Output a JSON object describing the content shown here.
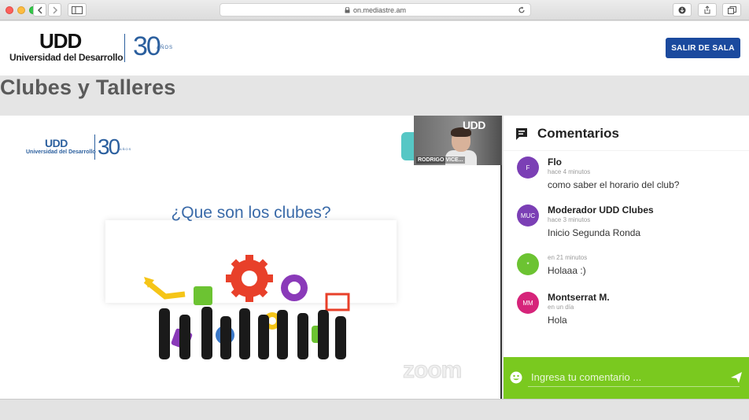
{
  "browser": {
    "url": "on.mediastre.am"
  },
  "header": {
    "logo_mark": "UDD",
    "logo_text": "Universidad del Desarrollo",
    "anniversary_number": "30",
    "anniversary_text": "AÑOS",
    "exit_button_label": "SALIR DE SALA"
  },
  "page": {
    "title": "Clubes y Talleres"
  },
  "presentation": {
    "slide_logo_mark": "UDD",
    "slide_logo_text": "Universidad del Desarrollo",
    "slide_anniversary_number": "30",
    "slide_anniversary_text": "AÑOS",
    "slide_question": "¿Que son los clubes?",
    "watermark": "zoom",
    "video_logo": "UDD",
    "video_participant_name": "RODRIGO VICE..."
  },
  "comments": {
    "title": "Comentarios",
    "items": [
      {
        "initials": "F",
        "author": "Flo",
        "time": "hace 4 minutos",
        "text": "como saber el horario del club?",
        "color": "#7b3fb5"
      },
      {
        "initials": "MUC",
        "author": "Moderador UDD Clubes",
        "time": "hace 3 minutos",
        "text": "Inicio Segunda Ronda",
        "color": "#7b3fb5"
      },
      {
        "initials": "*",
        "author": "",
        "time": "en 21 minutos",
        "text": "Holaaa :)",
        "color": "#6cc332"
      },
      {
        "initials": "MM",
        "author": "Montserrat M.",
        "time": "en un día",
        "text": "Hola",
        "color": "#d6247a"
      }
    ],
    "input_placeholder": "Ingresa tu comentario ..."
  },
  "colors": {
    "accent_blue": "#1b4a9e",
    "comment_bar_green": "#7ac91f"
  }
}
